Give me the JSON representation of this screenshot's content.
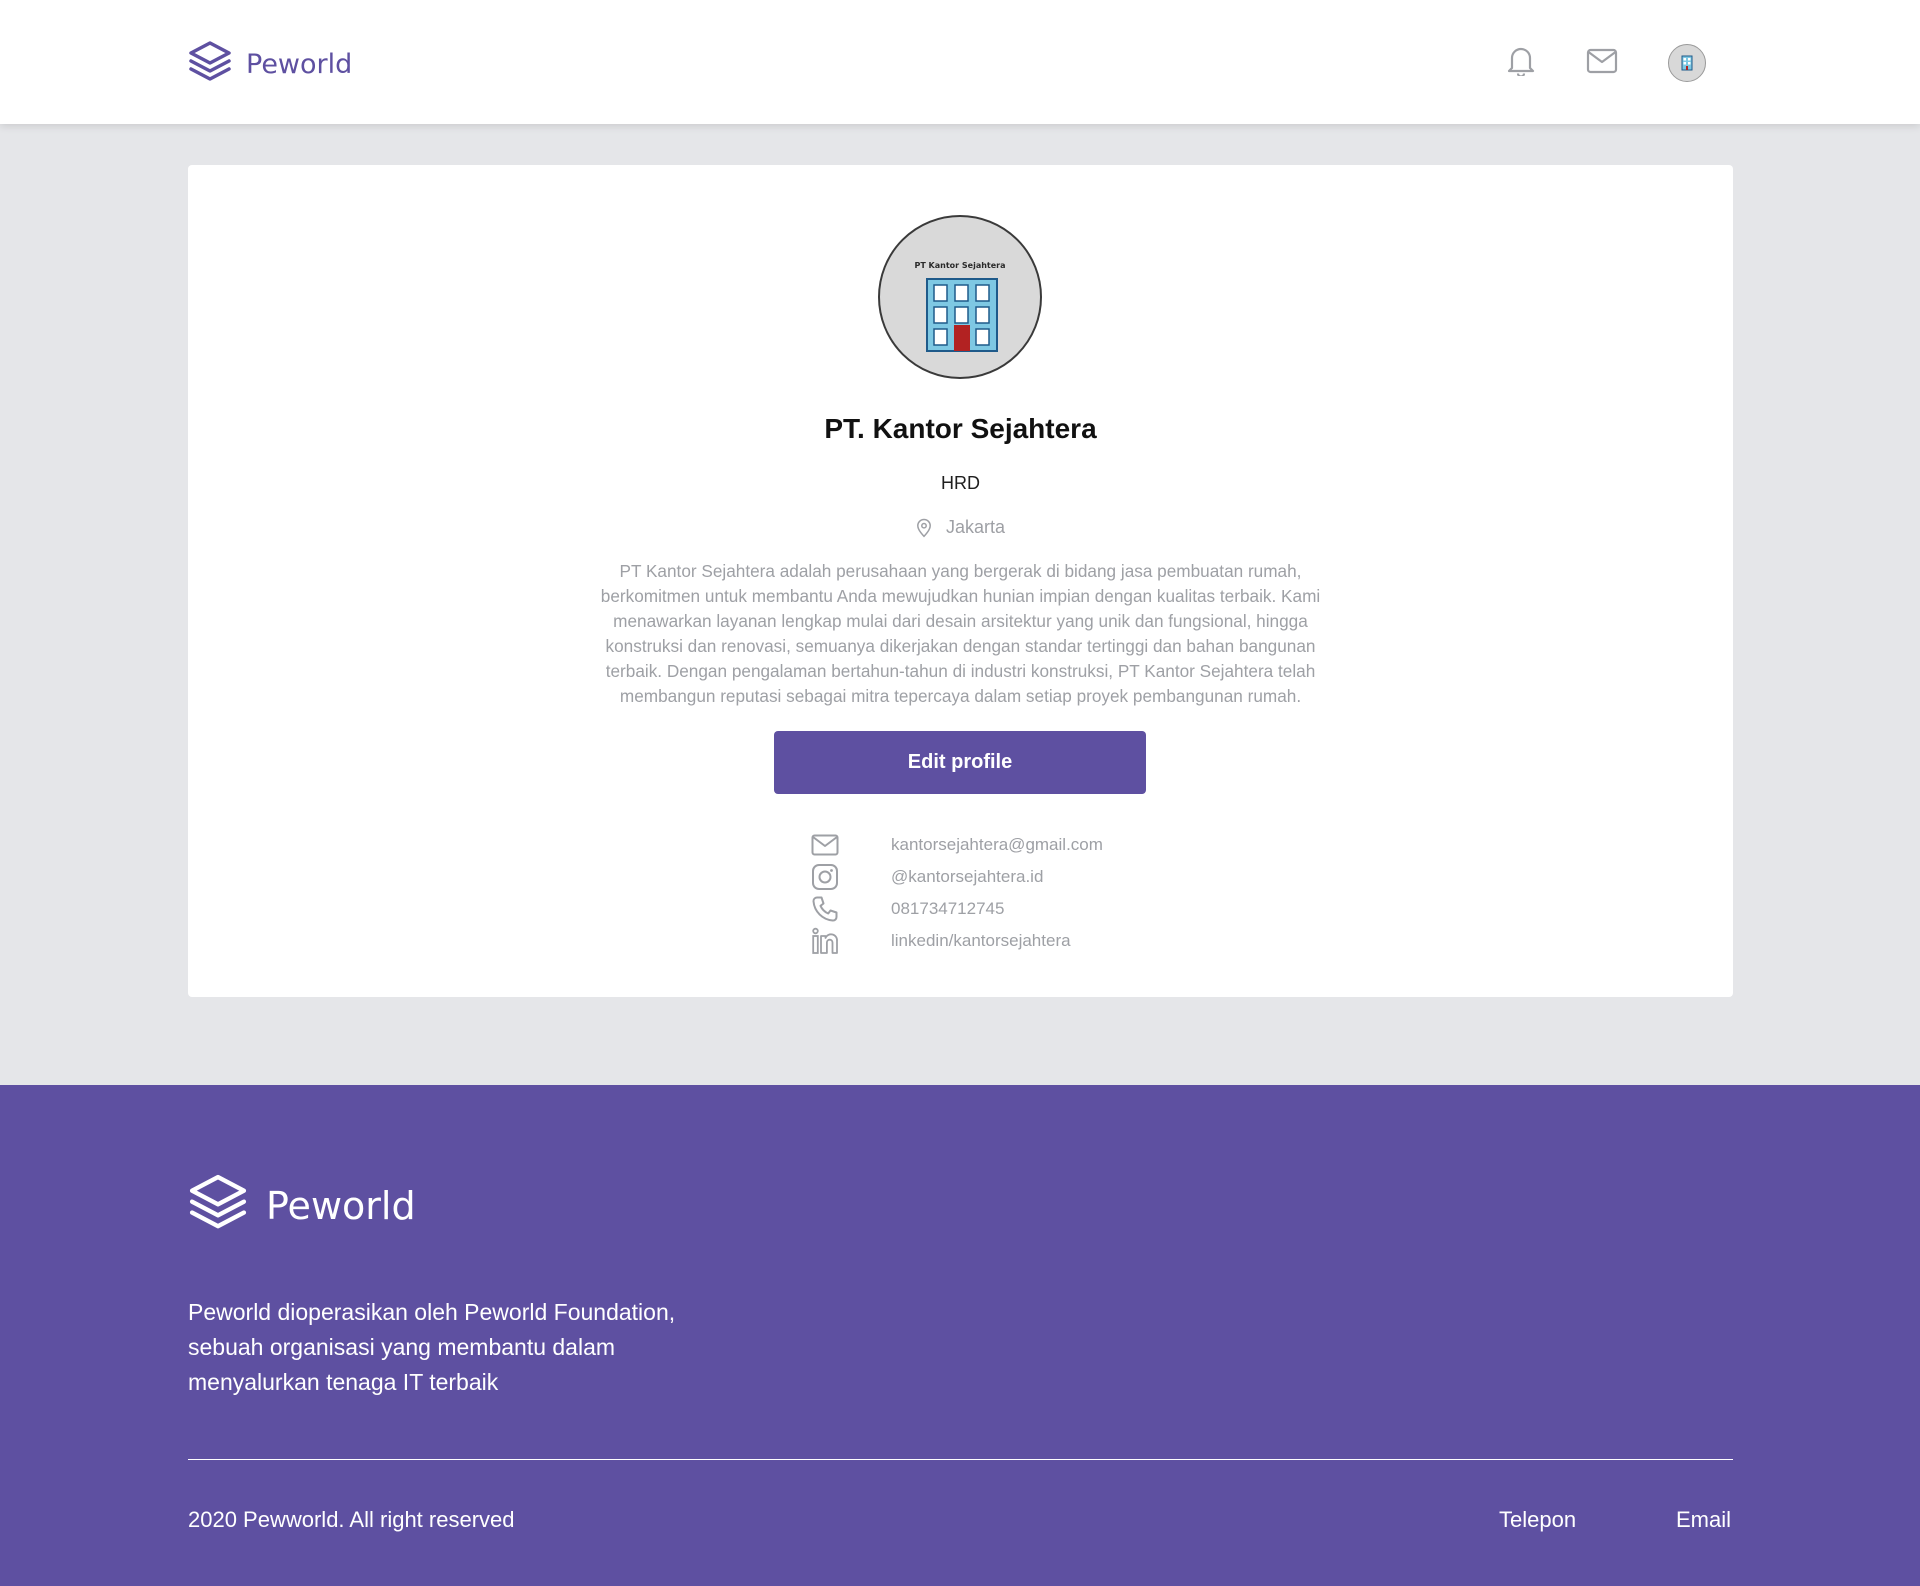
{
  "brand": {
    "name": "Peworld",
    "color": "#5e50a1"
  },
  "nav": {
    "icons": [
      "bell-icon",
      "mail-icon",
      "avatar"
    ]
  },
  "profile": {
    "logo_caption": "PT Kantor Sejahtera",
    "name": "PT. Kantor Sejahtera",
    "role": "HRD",
    "location": "Jakarta",
    "description": "PT Kantor Sejahtera adalah perusahaan yang bergerak di bidang jasa pembuatan rumah, berkomitmen untuk membantu Anda mewujudkan hunian impian dengan kualitas terbaik. Kami menawarkan layanan lengkap mulai dari desain arsitektur yang unik dan fungsional, hingga konstruksi dan renovasi, semuanya dikerjakan dengan standar tertinggi dan bahan bangunan terbaik. Dengan pengalaman bertahun-tahun di industri konstruksi, PT Kantor Sejahtera telah membangun reputasi sebagai mitra tepercaya dalam setiap proyek pembangunan rumah.",
    "edit_label": "Edit profile",
    "contacts": {
      "email": "kantorsejahtera@gmail.com",
      "instagram": "@kantorsejahtera.id",
      "phone": "081734712745",
      "linkedin": "linkedin/kantorsejahtera"
    }
  },
  "footer": {
    "description": "Peworld dioperasikan oleh Peworld Foundation, sebuah organisasi yang membantu dalam menyalurkan tenaga IT terbaik",
    "copyright": "2020 Pewworld. All right reserved",
    "links": {
      "telepon": "Telepon",
      "email": "Email"
    }
  }
}
